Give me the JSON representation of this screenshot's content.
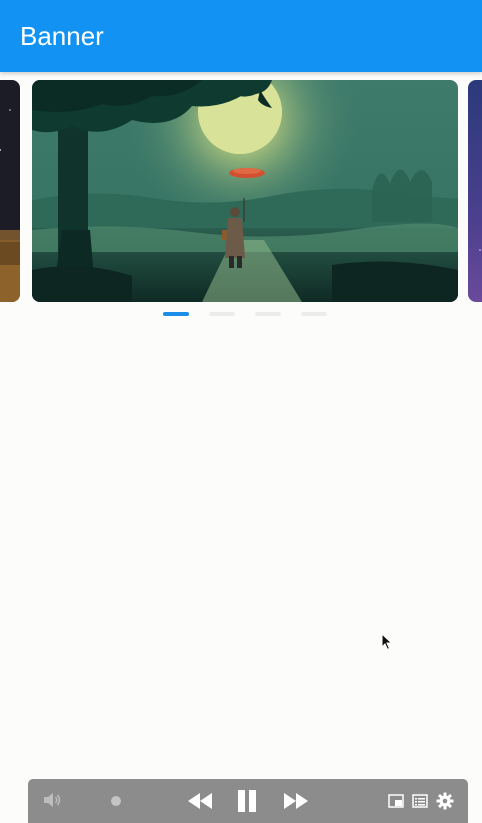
{
  "app_bar": {
    "title": "Banner",
    "color": "#1292f3"
  },
  "carousel": {
    "slide_count": 4,
    "active_index": 0,
    "indicator_active_color": "#1a8de8",
    "indicator_inactive_color": "#ececec"
  },
  "media_controls": {
    "background": "#8c8c8c",
    "icons": [
      "volume-icon",
      "record-icon",
      "rewind-icon",
      "pause-icon",
      "fast-forward-icon",
      "picture-in-picture-icon",
      "playlist-icon",
      "settings-gear-icon"
    ]
  }
}
